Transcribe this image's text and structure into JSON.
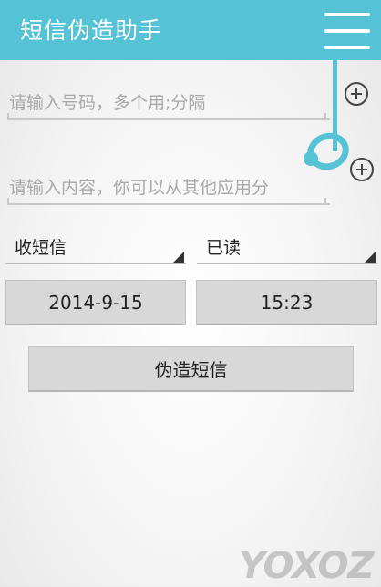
{
  "header": {
    "title": "短信伪造助手",
    "menu_icon": "hamburger-menu-icon",
    "bg_color": "#56c2d6"
  },
  "form": {
    "number_placeholder": "请输入号码，多个用;分隔",
    "content_placeholder": "请输入内容，你可以从其他应用分",
    "message_type": "收短信",
    "read_status": "已读",
    "date": "2014-9-15",
    "time": "15:23",
    "submit_label": "伪造短信"
  },
  "watermark": "YOXOZ"
}
